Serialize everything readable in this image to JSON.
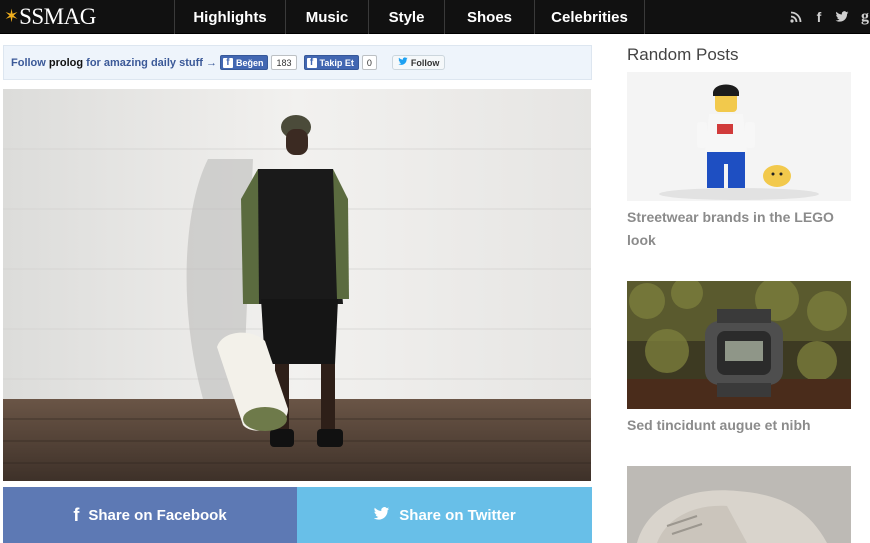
{
  "nav": {
    "logo_text": "SSMAG",
    "items": [
      {
        "label": "Highlights"
      },
      {
        "label": "Music"
      },
      {
        "label": "Style"
      },
      {
        "label": "Shoes"
      },
      {
        "label": "Celebrities"
      }
    ],
    "social": [
      "rss-icon",
      "facebook-icon",
      "twitter-icon",
      "google-plus-icon"
    ]
  },
  "follow_bar": {
    "prefix": "Follow ",
    "brand": "prolog",
    "suffix": " for amazing daily stuff →",
    "like_label": "Beğen",
    "like_count": "183",
    "follow_fb_label": "Takip Et",
    "follow_fb_count": "0",
    "twitter_label": "Follow"
  },
  "share": {
    "facebook_label": "Share on Facebook",
    "twitter_label": "Share on Twitter",
    "facebook_color": "#5d79b4",
    "twitter_color": "#68bfe8"
  },
  "sidebar": {
    "title": "Random Posts",
    "posts": [
      {
        "title": "Streetwear brands in the LEGO look"
      },
      {
        "title": "Sed tincidunt augue et nibh"
      }
    ]
  }
}
